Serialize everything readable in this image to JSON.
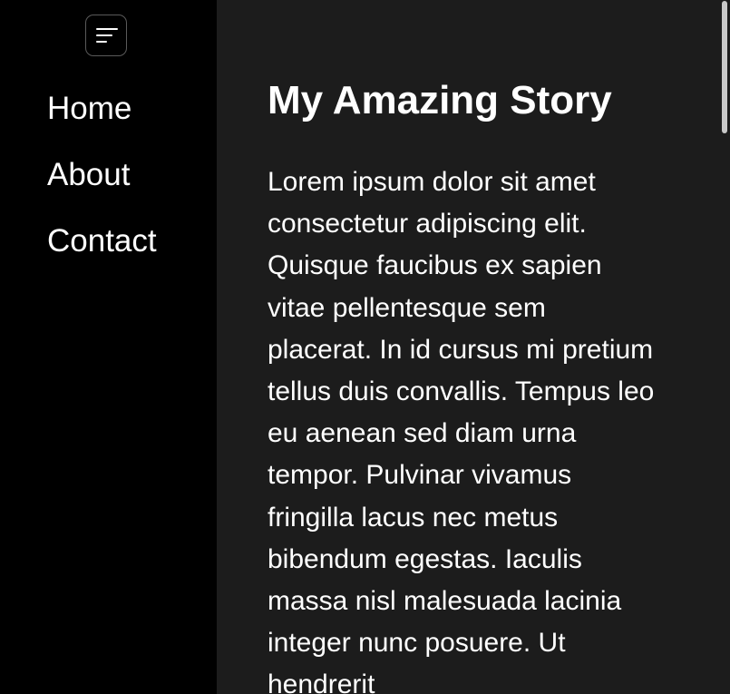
{
  "sidebar": {
    "menu_icon": "menu-lines-icon",
    "items": [
      {
        "label": "Home"
      },
      {
        "label": "About"
      },
      {
        "label": "Contact"
      }
    ]
  },
  "main": {
    "title": "My Amazing Story",
    "body": "Lorem ipsum dolor sit amet consectetur adipiscing elit. Quisque faucibus ex sapien vitae pellentesque sem placerat. In id cursus mi pretium tellus duis convallis. Tempus leo eu aenean sed diam urna tempor. Pulvinar vivamus fringilla lacus nec metus bibendum egestas. Iaculis massa nisl malesuada lacinia integer nunc posuere. Ut hendrerit"
  },
  "colors": {
    "sidebar_bg": "#000000",
    "content_bg": "#1c1c1c",
    "text": "#ffffff"
  }
}
